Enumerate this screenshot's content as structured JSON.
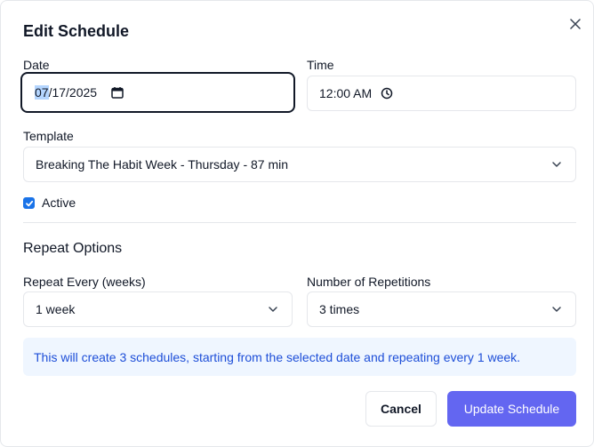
{
  "dialog": {
    "title": "Edit Schedule",
    "close_icon": "close-icon"
  },
  "date": {
    "label": "Date",
    "value_month": "07",
    "value_rest": "/17/2025",
    "icon": "calendar-icon"
  },
  "time": {
    "label": "Time",
    "value": "12:00 AM",
    "icon": "clock-icon"
  },
  "template": {
    "label": "Template",
    "selected": "Breaking The Habit Week - Thursday - 87 min"
  },
  "active": {
    "label": "Active",
    "checked": true
  },
  "repeat": {
    "section_title": "Repeat Options",
    "every_label": "Repeat Every (weeks)",
    "every_selected": "1 week",
    "count_label": "Number of Repetitions",
    "count_selected": "3 times"
  },
  "info": {
    "text": "This will create 3 schedules, starting from the selected date and repeating every 1 week."
  },
  "actions": {
    "cancel_label": "Cancel",
    "submit_label": "Update Schedule"
  },
  "colors": {
    "primary": "#6366f1",
    "info_bg": "#eff6ff",
    "info_text": "#1d4ed8",
    "checkbox": "#1a73e8"
  }
}
